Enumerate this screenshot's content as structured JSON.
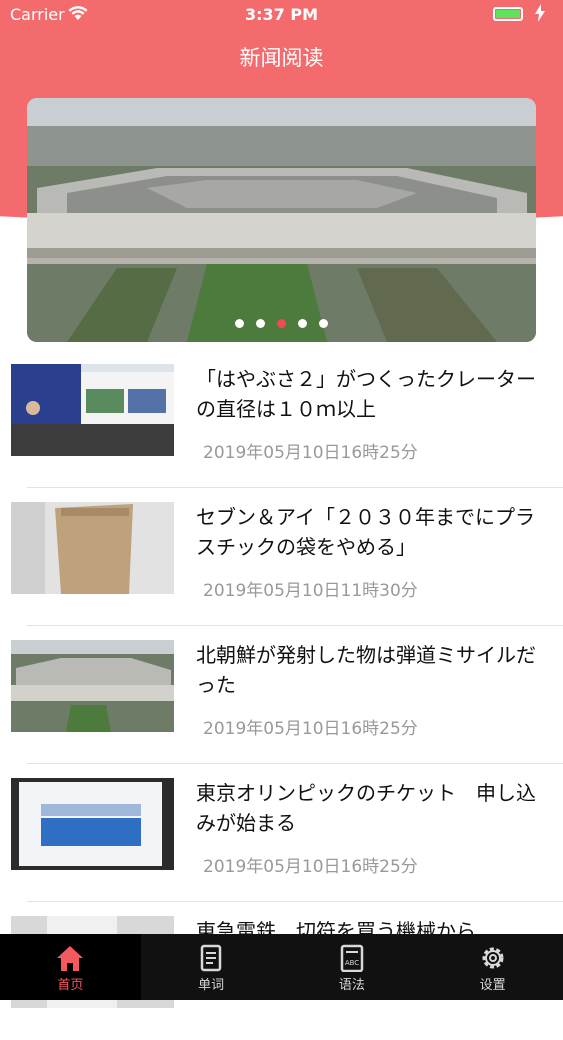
{
  "status": {
    "carrier": "Carrier",
    "time": "3:37 PM"
  },
  "header": {
    "title": "新闻阅读"
  },
  "banner": {
    "slide_count": 5,
    "active_index": 2
  },
  "news": [
    {
      "title": "「はやぶさ２」がつくったクレーターの直径は１０ｍ以上",
      "date": "2019年05月10日16時25分"
    },
    {
      "title": "セブン＆アイ「２０３０年までにプラスチックの袋をやめる」",
      "date": "2019年05月10日11時30分"
    },
    {
      "title": "北朝鮮が発射した物は弾道ミサイルだった",
      "date": "2019年05月10日16時25分"
    },
    {
      "title": "東京オリンピックのチケット　申し込みが始まる",
      "date": "2019年05月10日16時25分"
    },
    {
      "title": "東急電鉄　切符を買う機械から",
      "date": ""
    }
  ],
  "tabs": [
    {
      "label": "首页",
      "icon": "home-icon",
      "active": true
    },
    {
      "label": "单词",
      "icon": "words-icon",
      "active": false
    },
    {
      "label": "语法",
      "icon": "grammar-icon",
      "active": false
    },
    {
      "label": "设置",
      "icon": "settings-icon",
      "active": false
    }
  ],
  "colors": {
    "accent": "#f46b6e",
    "tab_active": "#f25a5f",
    "tab_bar": "#111111"
  }
}
